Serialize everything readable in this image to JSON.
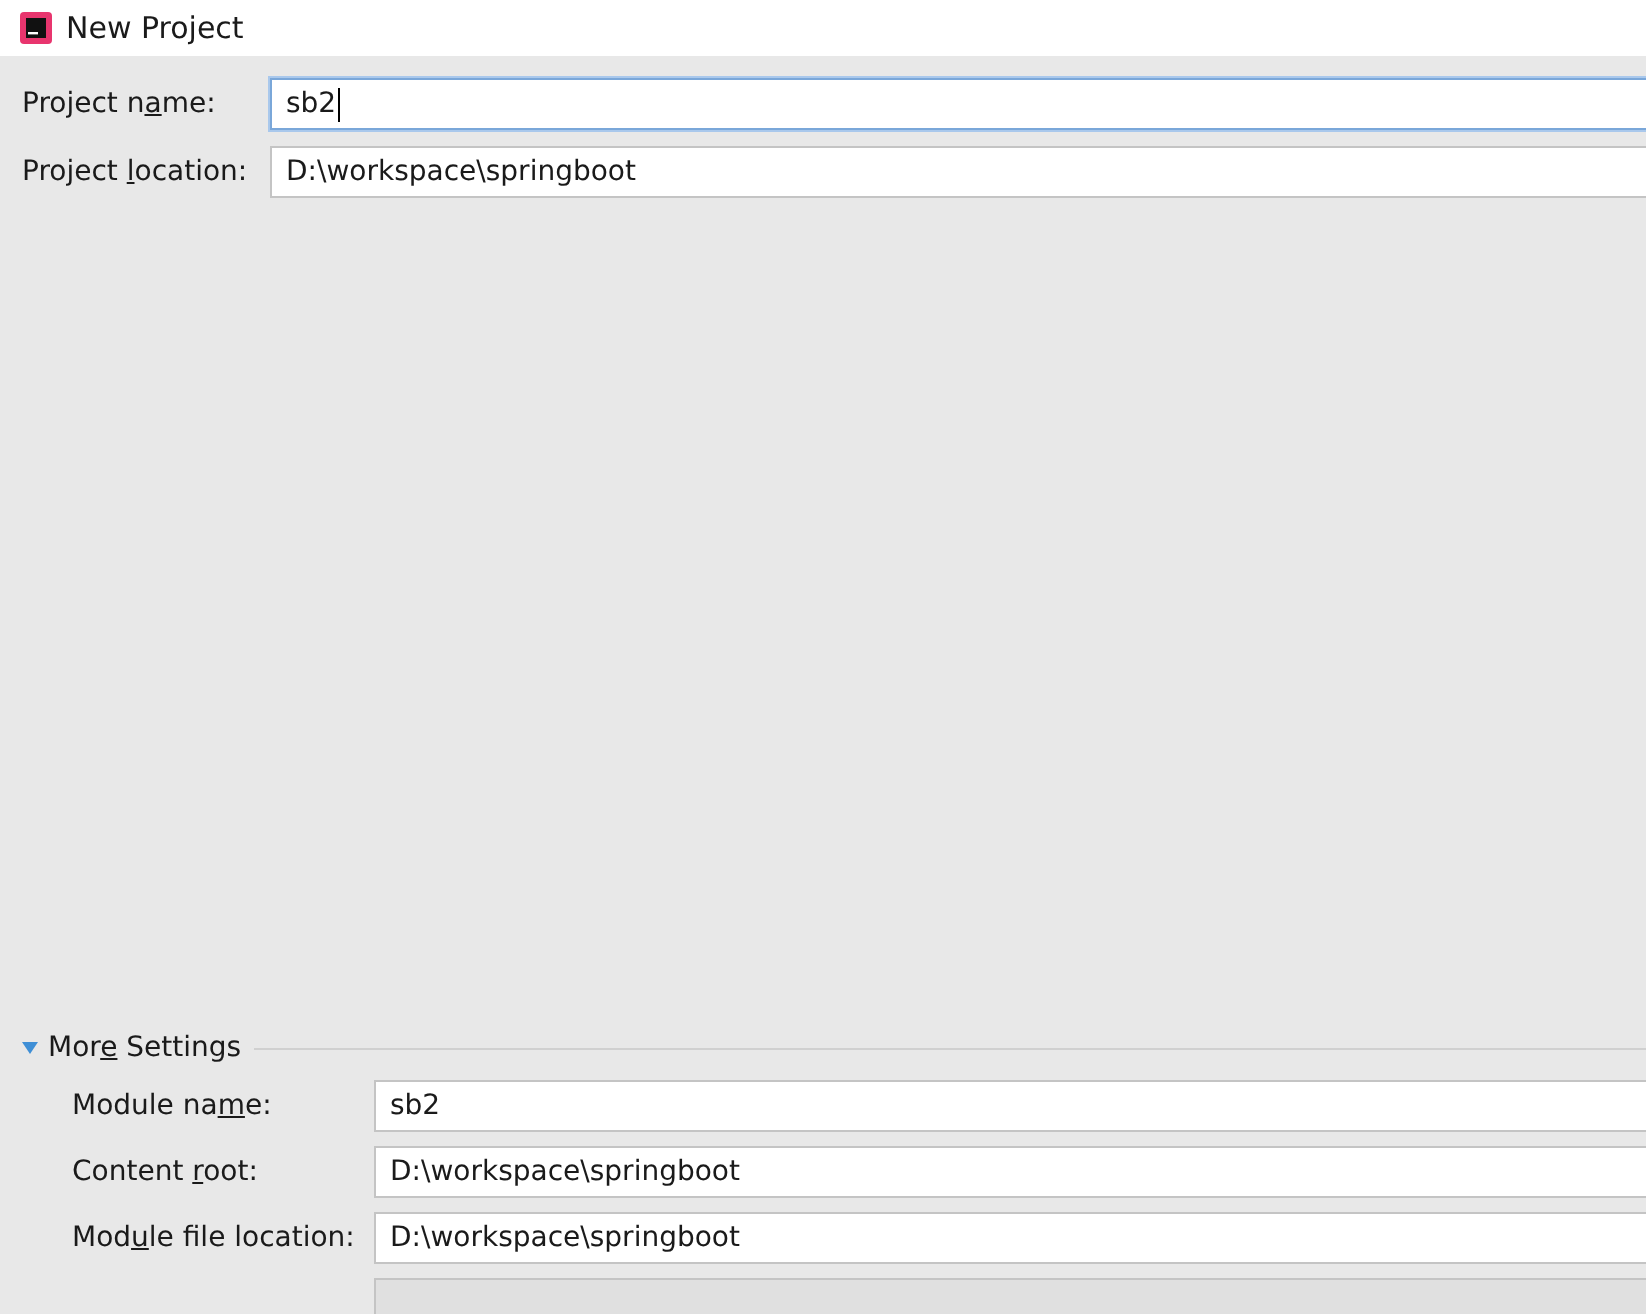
{
  "window": {
    "title": "New Project"
  },
  "project_fields": [
    {
      "label": {
        "before": "Project n",
        "key": "a",
        "after": "me:"
      },
      "value": "sb2",
      "focused": true
    },
    {
      "label": {
        "before": "Project ",
        "key": "l",
        "after": "ocation:"
      },
      "value": "D:\\workspace\\springboot",
      "focused": false
    }
  ],
  "more_settings": {
    "label": {
      "before": "Mor",
      "key": "e",
      "after": " Settings"
    },
    "expanded": true,
    "fields": [
      {
        "label": {
          "before": "Module na",
          "key": "m",
          "after": "e:"
        },
        "value": "sb2",
        "disabled": false
      },
      {
        "label": {
          "before": "Content ",
          "key": "r",
          "after": "oot:"
        },
        "value": "D:\\workspace\\springboot",
        "disabled": false
      },
      {
        "label": {
          "before": "Mod",
          "key": "u",
          "after": "le file location:"
        },
        "value": "D:\\workspace\\springboot",
        "disabled": false
      },
      {
        "disabled": true
      }
    ]
  }
}
